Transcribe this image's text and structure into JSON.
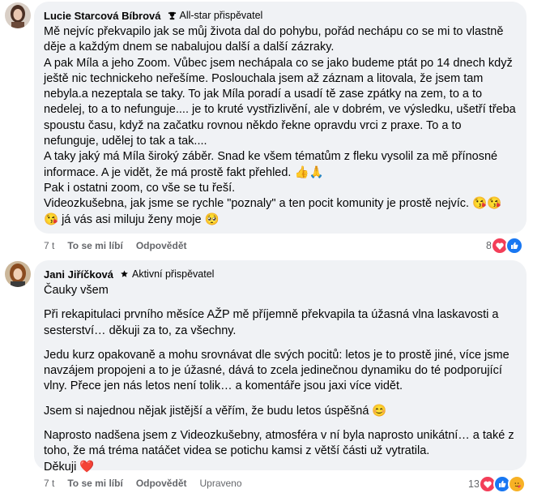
{
  "comments": [
    {
      "author": "Lucie Starcová Bíbrová",
      "badge": "All-star přispěvatel",
      "paragraphs": [
        "Mě nejvíc překvapilo jak se můj života dal do pohybu, pořád nechápu co se mi to vlastně děje a každým dnem se nabalujou další a další zázraky.",
        "A pak Míla a jeho Zoom. Vůbec jsem nechápala co se jako budeme ptát po 14 dnech když ještě nic technickeho neřešíme. Poslouchala jsem až záznam a litovala, že jsem tam nebyla.a nezeptala se taky. To jak Míla poradí a usadí tě zase zpátky na zem, to a to nedelej, to a to nefunguje.... je to kruté vystřizlivění, ale v dobrém, ve výsledku, ušetří třeba spoustu času, když na začatku rovnou někdo řekne opravdu vrci z praxe. To a to nefunguje, udělej to tak a tak....",
        "A taky jaký má Míla široký záběr. Snad ke všem tématům z fleku vysolil za mě přínosné informace. A je vidět, že má prostě fakt přehled. 👍🙏",
        "Pak i ostatni zoom, co vše se tu řeší.",
        "Videozkušebna, jak jsme se rychle \"poznaly\" a ten pocit komunity je prostě nejvíc. 😘😘 😘 já vás asi miluju ženy moje 🥺"
      ],
      "time": "7 t",
      "like_label": "To se mi líbí",
      "reply_label": "Odpovědět",
      "reaction_count": "8"
    },
    {
      "author": "Jani Jiříčková",
      "badge": "Aktivní přispěvatel",
      "paragraphs": [
        "Čauky všem",
        "Při rekapitulaci prvního měsíce AŽP mě příjemně překvapila ta úžasná vlna laskavosti a sesterství… děkuji za to, za všechny.",
        "Jedu kurz opakovaně a mohu srovnávat dle svých pocitů: letos je to prostě jiné, více jsme navzájem propojeni a to je úžasné, dává to zcela jedinečnou dynamiku do té podporující vlny. Přece jen nás letos není tolik… a komentáře jsou jaxi více vidět.",
        "Jsem si najednou nějak jistější a věřím, že budu letos úspěšná 😊",
        "Naprosto nadšena jsem z Videozkušebny, atmosféra v ní byla naprosto unikátní… a také z toho, že má tréma natáčet videa se potichu kamsi z větší části už vytratila.",
        "Děkuji ❤️"
      ],
      "time": "7 t",
      "like_label": "To se mi líbí",
      "reply_label": "Odpovědět",
      "edited_label": "Upraveno",
      "reaction_count": "13"
    }
  ],
  "colors": {
    "bubble": "#f0f2f5",
    "meta_text": "#65676b",
    "like_blue": "#1877f2",
    "love_red": "#f33e58",
    "haha_yellow": "#f7b125"
  }
}
